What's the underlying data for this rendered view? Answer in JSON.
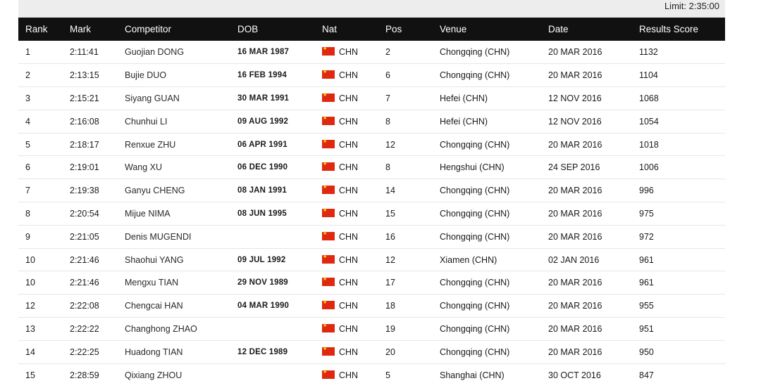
{
  "limit_label": "Limit: 2:35:00",
  "headers": {
    "rank": "Rank",
    "mark": "Mark",
    "competitor": "Competitor",
    "dob": "DOB",
    "nat": "Nat",
    "pos": "Pos",
    "venue": "Venue",
    "date": "Date",
    "score": "Results Score"
  },
  "flag_color": "#de2910",
  "rows": [
    {
      "rank": "1",
      "mark": "2:11:41",
      "competitor": "Guojian DONG",
      "dob": "16 MAR 1987",
      "nat": "CHN",
      "pos": "2",
      "venue": "Chongqing (CHN)",
      "date": "20 MAR 2016",
      "score": "1132"
    },
    {
      "rank": "2",
      "mark": "2:13:15",
      "competitor": "Bujie DUO",
      "dob": "16 FEB 1994",
      "nat": "CHN",
      "pos": "6",
      "venue": "Chongqing (CHN)",
      "date": "20 MAR 2016",
      "score": "1104"
    },
    {
      "rank": "3",
      "mark": "2:15:21",
      "competitor": "Siyang GUAN",
      "dob": "30 MAR 1991",
      "nat": "CHN",
      "pos": "7",
      "venue": "Hefei (CHN)",
      "date": "12 NOV 2016",
      "score": "1068"
    },
    {
      "rank": "4",
      "mark": "2:16:08",
      "competitor": "Chunhui LI",
      "dob": "09 AUG 1992",
      "nat": "CHN",
      "pos": "8",
      "venue": "Hefei (CHN)",
      "date": "12 NOV 2016",
      "score": "1054"
    },
    {
      "rank": "5",
      "mark": "2:18:17",
      "competitor": "Renxue ZHU",
      "dob": "06 APR 1991",
      "nat": "CHN",
      "pos": "12",
      "venue": "Chongqing (CHN)",
      "date": "20 MAR 2016",
      "score": "1018"
    },
    {
      "rank": "6",
      "mark": "2:19:01",
      "competitor": "Wang XU",
      "dob": "06 DEC 1990",
      "nat": "CHN",
      "pos": "8",
      "venue": "Hengshui (CHN)",
      "date": "24 SEP 2016",
      "score": "1006"
    },
    {
      "rank": "7",
      "mark": "2:19:38",
      "competitor": "Ganyu CHENG",
      "dob": "08 JAN 1991",
      "nat": "CHN",
      "pos": "14",
      "venue": "Chongqing (CHN)",
      "date": "20 MAR 2016",
      "score": "996"
    },
    {
      "rank": "8",
      "mark": "2:20:54",
      "competitor": "Mijue NIMA",
      "dob": "08 JUN 1995",
      "nat": "CHN",
      "pos": "15",
      "venue": "Chongqing (CHN)",
      "date": "20 MAR 2016",
      "score": "975"
    },
    {
      "rank": "9",
      "mark": "2:21:05",
      "competitor": "Denis MUGENDI",
      "dob": "",
      "nat": "CHN",
      "pos": "16",
      "venue": "Chongqing (CHN)",
      "date": "20 MAR 2016",
      "score": "972"
    },
    {
      "rank": "10",
      "mark": "2:21:46",
      "competitor": "Shaohui YANG",
      "dob": "09 JUL 1992",
      "nat": "CHN",
      "pos": "12",
      "venue": "Xiamen (CHN)",
      "date": "02 JAN 2016",
      "score": "961"
    },
    {
      "rank": "10",
      "mark": "2:21:46",
      "competitor": "Mengxu TIAN",
      "dob": "29 NOV 1989",
      "nat": "CHN",
      "pos": "17",
      "venue": "Chongqing (CHN)",
      "date": "20 MAR 2016",
      "score": "961"
    },
    {
      "rank": "12",
      "mark": "2:22:08",
      "competitor": "Chengcai HAN",
      "dob": "04 MAR 1990",
      "nat": "CHN",
      "pos": "18",
      "venue": "Chongqing (CHN)",
      "date": "20 MAR 2016",
      "score": "955"
    },
    {
      "rank": "13",
      "mark": "2:22:22",
      "competitor": "Changhong ZHAO",
      "dob": "",
      "nat": "CHN",
      "pos": "19",
      "venue": "Chongqing (CHN)",
      "date": "20 MAR 2016",
      "score": "951"
    },
    {
      "rank": "14",
      "mark": "2:22:25",
      "competitor": "Huadong TIAN",
      "dob": "12 DEC 1989",
      "nat": "CHN",
      "pos": "20",
      "venue": "Chongqing (CHN)",
      "date": "20 MAR 2016",
      "score": "950"
    },
    {
      "rank": "15",
      "mark": "2:28:59",
      "competitor": "Qixiang ZHOU",
      "dob": "",
      "nat": "CHN",
      "pos": "5",
      "venue": "Shanghai (CHN)",
      "date": "30 OCT 2016",
      "score": "847"
    }
  ]
}
